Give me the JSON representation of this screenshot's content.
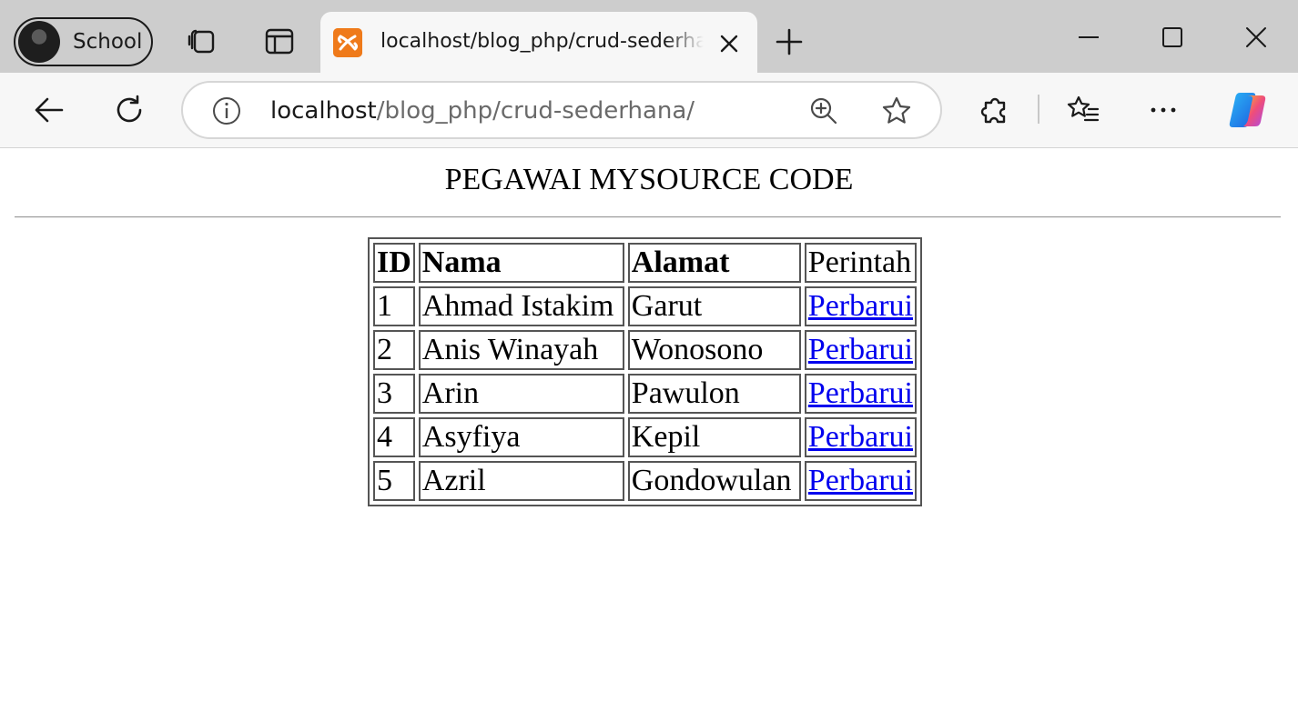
{
  "browser": {
    "profile_label": "School",
    "tab_title": "localhost/blog_php/crud-sederhana/",
    "url_host": "localhost",
    "url_path": "/blog_php/crud-sederhana/",
    "favicon_color": "#ef7a1a",
    "icons": {
      "workspaces": "workspaces-icon",
      "tab_actions": "vertical-tabs-icon",
      "new_tab": "plus-icon",
      "minimize": "minimize-icon",
      "maximize": "maximize-icon",
      "close": "close-icon",
      "back": "back-arrow-icon",
      "refresh": "refresh-icon",
      "site_info": "info-icon",
      "zoom": "zoom-in-icon",
      "favorite": "star-icon",
      "extensions": "puzzle-icon",
      "favorites": "favorites-list-icon",
      "more": "more-dots-icon",
      "copilot": "copilot-icon"
    }
  },
  "page": {
    "title": "PEGAWAI MYSOURCE CODE",
    "table": {
      "headers": [
        "ID",
        "Nama",
        "Alamat",
        "Perintah"
      ],
      "rows": [
        {
          "id": "1",
          "nama": "Ahmad Istakim",
          "alamat": "Garut",
          "action": "Perbarui"
        },
        {
          "id": "2",
          "nama": "Anis Winayah",
          "alamat": "Wonosono",
          "action": "Perbarui"
        },
        {
          "id": "3",
          "nama": "Arin",
          "alamat": "Pawulon",
          "action": "Perbarui"
        },
        {
          "id": "4",
          "nama": "Asyfiya",
          "alamat": "Kepil",
          "action": "Perbarui"
        },
        {
          "id": "5",
          "nama": "Azril",
          "alamat": "Gondowulan",
          "action": "Perbarui"
        }
      ]
    },
    "link_color": "#0000ee"
  }
}
